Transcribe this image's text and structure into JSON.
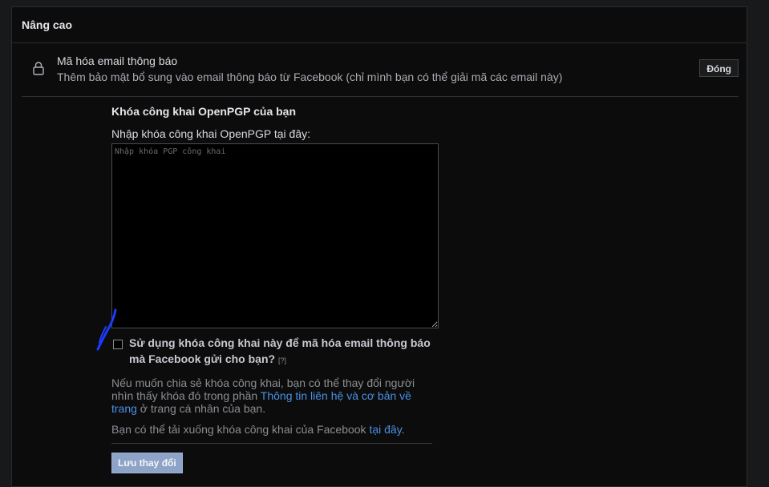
{
  "header": {
    "title": "Nâng cao"
  },
  "encryption_row": {
    "title": "Mã hóa email thông báo",
    "subtitle": "Thêm bảo mật bổ sung vào email thông báo từ Facebook (chỉ mình bạn có thể giải mã các email này)",
    "close_label": "Đóng"
  },
  "pgp": {
    "section_title": "Khóa công khai OpenPGP của bạn",
    "field_label": "Nhập khóa công khai OpenPGP tại đây:",
    "placeholder": "Nhập khóa PGP công khai",
    "value": ""
  },
  "checkbox": {
    "label": "Sử dụng khóa công khai này để mã hóa email thông báo mà Facebook gửi cho bạn?",
    "help": "[?]",
    "checked": false
  },
  "info": {
    "text1": "Nếu muốn chia sẻ khóa công khai, bạn có thể thay đổi người nhìn thấy khóa đó trong phần ",
    "link1": "Thông tin liên hệ và cơ bản về trang",
    "text2": " ở trang cá nhân của bạn.",
    "download_text": "Bạn có thể tải xuống khóa công khai của Facebook ",
    "download_link": "tại đây",
    "download_end": "."
  },
  "save_label": "Lưu thay đổi",
  "icons": {
    "lock": "lock-icon",
    "annotation": "pen-mark"
  },
  "colors": {
    "link": "#4a90e2",
    "save_button": "#8ea3c8",
    "pen_mark": "#1a3cff"
  }
}
